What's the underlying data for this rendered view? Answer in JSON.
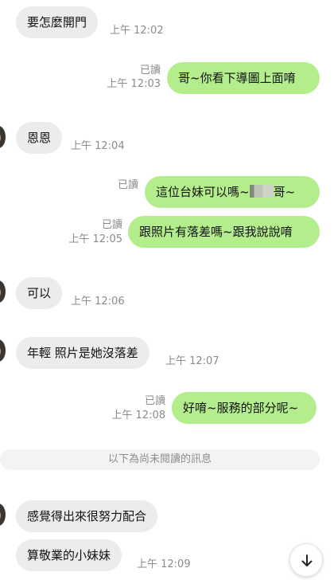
{
  "chat": {
    "messages": [
      {
        "direction": "incoming",
        "text": "要怎麼開門",
        "time": "上午 12:02"
      },
      {
        "direction": "outgoing",
        "read_label": "已讀",
        "text": "哥~你看下導圖上面唷",
        "time": "上午 12:03"
      },
      {
        "direction": "incoming",
        "text": "恩恩",
        "time": "上午 12:04"
      },
      {
        "direction": "outgoing",
        "read_label": "已讀",
        "text_before": "這位台妹可以嗎~",
        "text_after": "哥~"
      },
      {
        "direction": "outgoing",
        "read_label": "已讀",
        "text": "跟照片有落差嗎~跟我說說唷",
        "time": "上午 12:05"
      },
      {
        "direction": "incoming",
        "text": "可以",
        "time": "上午 12:06"
      },
      {
        "direction": "incoming",
        "text": "年輕 照片是她沒落差",
        "time": "上午 12:07"
      },
      {
        "direction": "outgoing",
        "read_label": "已讀",
        "text": "好唷~服務的部分呢~",
        "time": "上午 12:08"
      },
      {
        "direction": "incoming",
        "text": "感覺得出來很努力配合"
      },
      {
        "direction": "incoming",
        "text": "算敬業的小妹妹",
        "time": "上午 12:09"
      }
    ],
    "unread_divider": "以下為尚未閱讀的訊息"
  },
  "controls": {
    "scroll_button_icon": "arrow-down-icon"
  },
  "colors": {
    "incoming_bubble": "#ececee",
    "outgoing_bubble": "#b4ed8c",
    "meta_text": "#8b8b8b",
    "divider_background": "#f3f3f5"
  }
}
